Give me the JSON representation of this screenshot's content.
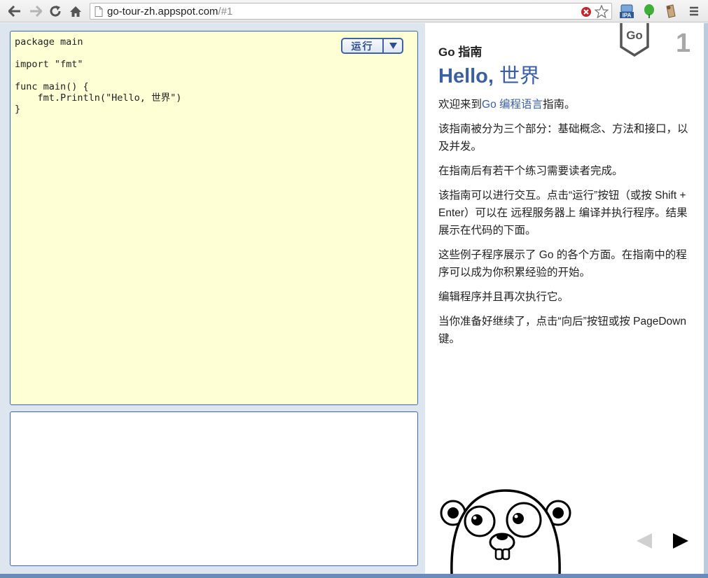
{
  "browser": {
    "url_host": "go-tour-zh.appspot.com",
    "url_path": "/#1"
  },
  "editor": {
    "code": "package main\n\nimport \"fmt\"\n\nfunc main() {\n    fmt.Println(\"Hello, 世界\")\n}",
    "run_label": "运行"
  },
  "slide": {
    "badge_label": "Go",
    "number": "1",
    "section": "Go 指南",
    "title_latin": "Hello,",
    "title_cjk": " 世界",
    "p1_pre": "欢迎来到",
    "p1_link": "Go 编程语言",
    "p1_post": "指南。",
    "p2": "该指南被分为三个部分：基础概念、方法和接口，以及并发。",
    "p3": "在指南后有若干个练习需要读者完成。",
    "p4": "该指南可以进行交互。点击“运行”按钮（或按 Shift + Enter）可以在 远程服务器上 编译并执行程序。结果展示在代码的下面。",
    "p5": "这些例子程序展示了 Go 的各个方面。在指南中的程序可以成为你积累经验的开始。",
    "p6": "编辑程序并且再次执行它。",
    "p7": "当你准备好继续了，点击“向后”按钮或按 PageDown 键。"
  }
}
